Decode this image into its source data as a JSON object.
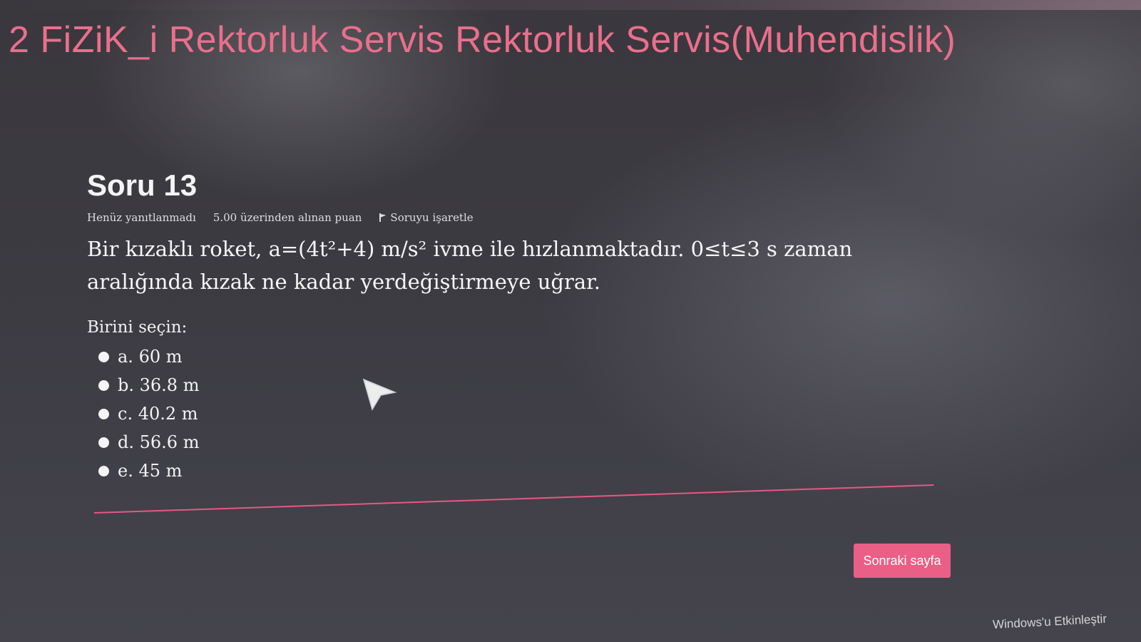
{
  "page": {
    "course_title": "2 FiZiK_i Rektorluk Servis Rektorluk Servis(Muhendislik)"
  },
  "question": {
    "header": "Soru 13",
    "status": "Henüz yanıtlanmadı",
    "points": "5.00 üzerinden alınan puan",
    "flag_label": "Soruyu işaretle",
    "text": "Bir kızaklı roket, a=(4t²+4) m/s² ivme ile hızlanmaktadır. 0≤t≤3 s zaman aralığında kızak ne kadar yerdeğiştirmeye uğrar.",
    "prompt": "Birini seçin:",
    "answers": [
      {
        "label": "a. 60 m"
      },
      {
        "label": "b. 36.8 m"
      },
      {
        "label": "c. 40.2 m"
      },
      {
        "label": "d. 56.6 m"
      },
      {
        "label": "e. 45 m"
      }
    ]
  },
  "navigation": {
    "next_label": "Sonraki sayfa"
  },
  "watermark": {
    "text": "Windows'u Etkinleştir"
  },
  "icons": {
    "flag": "flag-icon",
    "cursor": "mouse-pointer-icon"
  },
  "colors": {
    "accent": "#ea5f86",
    "title": "#ea6f8c",
    "background": "#3c3b42"
  }
}
